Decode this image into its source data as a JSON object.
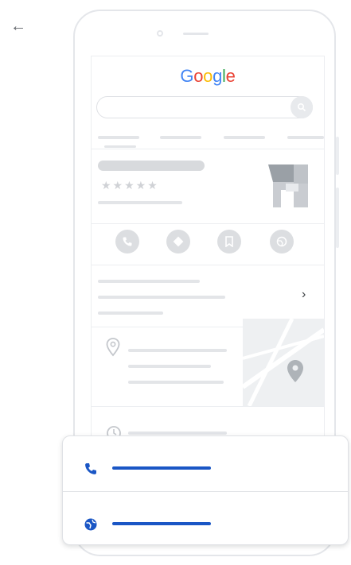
{
  "header": {
    "back_icon": "arrow-left-icon"
  },
  "phone": {
    "logo_text": "Google",
    "logo_colors": [
      "#4285F4",
      "#EA4335",
      "#FBBC05",
      "#4285F4",
      "#34A853",
      "#EA4335"
    ],
    "rating_stars": "★★★★★",
    "action_icons": [
      "phone-icon",
      "directions-icon",
      "save-icon",
      "website-icon"
    ],
    "more_chevron": "›"
  },
  "popup": {
    "accent_color": "#1a56c5",
    "rows": [
      {
        "icon": "phone-icon"
      },
      {
        "icon": "globe-icon"
      }
    ]
  }
}
